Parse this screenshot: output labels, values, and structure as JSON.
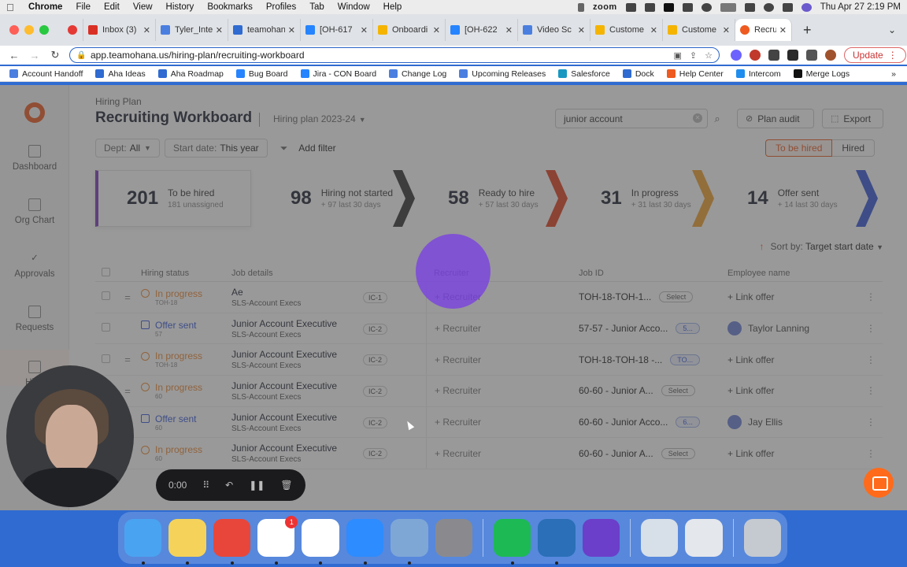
{
  "menubar": {
    "app": "Chrome",
    "items": [
      "File",
      "Edit",
      "View",
      "History",
      "Bookmarks",
      "Profiles",
      "Tab",
      "Window",
      "Help"
    ],
    "zoom": "zoom",
    "datetime": "Thu Apr 27  2:19 PM"
  },
  "tabs": [
    {
      "label": "",
      "color": "#e53935"
    },
    {
      "label": "Inbox (3)",
      "color": "#d93025"
    },
    {
      "label": "Tyler_Inte",
      "color": "#4a7fe0"
    },
    {
      "label": "teamohan",
      "color": "#2f6bd1"
    },
    {
      "label": "[OH-617",
      "color": "#2684ff"
    },
    {
      "label": "Onboardi",
      "color": "#f4b400"
    },
    {
      "label": "[OH-622",
      "color": "#2684ff"
    },
    {
      "label": "Video Sc",
      "color": "#4a7fe0"
    },
    {
      "label": "Custome",
      "color": "#f4b400"
    },
    {
      "label": "Custome",
      "color": "#f4b400"
    },
    {
      "label": "Recru",
      "color": "#ee5a1f"
    }
  ],
  "addressbar": {
    "url": "app.teamohana.us/hiring-plan/recruiting-workboard",
    "update_label": "Update"
  },
  "bookmarks": [
    {
      "label": "Account Handoff",
      "color": "#4a7fe0"
    },
    {
      "label": "Aha Ideas",
      "color": "#2f6bd1"
    },
    {
      "label": "Aha Roadmap",
      "color": "#2f6bd1"
    },
    {
      "label": "Bug Board",
      "color": "#2684ff"
    },
    {
      "label": "Jira - CON Board",
      "color": "#2684ff"
    },
    {
      "label": "Change Log",
      "color": "#4a7fe0"
    },
    {
      "label": "Upcoming Releases",
      "color": "#4a7fe0"
    },
    {
      "label": "Salesforce",
      "color": "#1798c1"
    },
    {
      "label": "Dock",
      "color": "#2f6bd1"
    },
    {
      "label": "Help Center",
      "color": "#ee5a1f"
    },
    {
      "label": "Intercom",
      "color": "#1f8ded"
    },
    {
      "label": "Merge Logs",
      "color": "#111111"
    }
  ],
  "sidebar": {
    "items": [
      {
        "label": "Dashboard"
      },
      {
        "label": "Org Chart"
      },
      {
        "label": "Approvals"
      },
      {
        "label": "Requests"
      },
      {
        "label": "Hirin"
      }
    ]
  },
  "header": {
    "breadcrumb": "Hiring Plan",
    "title": "Recruiting Workboard",
    "plan_select": "Hiring plan 2023-24",
    "search_value": "junior account",
    "plan_audit": "Plan audit",
    "export": "Export"
  },
  "filters": {
    "dept_label": "Dept:",
    "dept_value": "All",
    "start_label": "Start date:",
    "start_value": "This year",
    "add_filter": "Add filter",
    "toggle_on": "To be hired",
    "toggle_off": "Hired"
  },
  "summary": [
    {
      "num": "201",
      "title": "To be hired",
      "sub": "181 unassigned",
      "color": "#7b3bbd"
    },
    {
      "num": "98",
      "title": "Hiring not started",
      "sub": "+ 97 last 30 days",
      "color": "#333333"
    },
    {
      "num": "58",
      "title": "Ready to hire",
      "sub": "+ 57 last 30 days",
      "color": "#e0401f"
    },
    {
      "num": "31",
      "title": "In progress",
      "sub": "+ 31 last 30 days",
      "color": "#f0a030"
    },
    {
      "num": "14",
      "title": "Offer sent",
      "sub": "+ 14 last 30 days",
      "color": "#3658d8"
    }
  ],
  "sort": {
    "label": "Sort by:",
    "value": "Target start date"
  },
  "table": {
    "columns": [
      "Hiring status",
      "Job details",
      "Recruiter",
      "Job ID",
      "Employee name"
    ],
    "rows": [
      {
        "status": "In progress",
        "status_id": "TOH-18",
        "job": "Ae",
        "dept": "SLS-Account Execs",
        "level": "IC-1",
        "recruiter": "+ Recruiter",
        "job_id": "TOH-18-TOH-1...",
        "tag": "Select",
        "employee": "+ Link offer",
        "sent": false
      },
      {
        "status": "Offer sent",
        "status_id": "57",
        "job": "Junior Account Executive",
        "dept": "SLS-Account Execs",
        "level": "IC-2",
        "recruiter": "+ Recruiter",
        "job_id": "57-57 - Junior Acco...",
        "tag": "5...",
        "employee": "Taylor Lanning",
        "sent": true
      },
      {
        "status": "In progress",
        "status_id": "TOH-18",
        "job": "Junior Account Executive",
        "dept": "SLS-Account Execs",
        "level": "IC-2",
        "recruiter": "+ Recruiter",
        "job_id": "TOH-18-TOH-18 -...",
        "tag": "TO...",
        "employee": "+ Link offer",
        "sent": false
      },
      {
        "status": "In progress",
        "status_id": "60",
        "job": "Junior Account Executive",
        "dept": "SLS-Account Execs",
        "level": "IC-2",
        "recruiter": "+ Recruiter",
        "job_id": "60-60 - Junior A...",
        "tag": "Select",
        "employee": "+ Link offer",
        "sent": false
      },
      {
        "status": "Offer sent",
        "status_id": "60",
        "job": "Junior Account Executive",
        "dept": "SLS-Account Execs",
        "level": "IC-2",
        "recruiter": "+ Recruiter",
        "job_id": "60-60 - Junior Acco...",
        "tag": "6...",
        "employee": "Jay Ellis",
        "sent": true
      },
      {
        "status": "In progress",
        "status_id": "60",
        "job": "Junior Account Executive",
        "dept": "SLS-Account Execs",
        "level": "IC-2",
        "recruiter": "+ Recruiter",
        "job_id": "60-60 - Junior A...",
        "tag": "Select",
        "employee": "+ Link offer",
        "sent": false
      }
    ]
  },
  "recorder": {
    "time": "0:00"
  },
  "dock": [
    {
      "name": "Finder",
      "color": "#4aa3f0"
    },
    {
      "name": "Notes",
      "color": "#f5d35a"
    },
    {
      "name": "Chrome",
      "color": "#e8463a"
    },
    {
      "name": "Slack",
      "color": "#ffffff"
    },
    {
      "name": "Notion",
      "color": "#ffffff"
    },
    {
      "name": "Zoom",
      "color": "#2d8cff"
    },
    {
      "name": "Preview",
      "color": "#7fa7d6"
    },
    {
      "name": "System Settings",
      "color": "#8a8a8e"
    },
    {
      "name": "Spotify",
      "color": "#1db954"
    },
    {
      "name": "QuickTime",
      "color": "#2a6fb7"
    },
    {
      "name": "iMovie",
      "color": "#6b3fc9"
    },
    {
      "name": "Screenshots",
      "color": "#d7dfe8"
    },
    {
      "name": "Downloads",
      "color": "#e4e7ec"
    },
    {
      "name": "Trash",
      "color": "#c5cad1"
    }
  ],
  "dock_badge": "1"
}
